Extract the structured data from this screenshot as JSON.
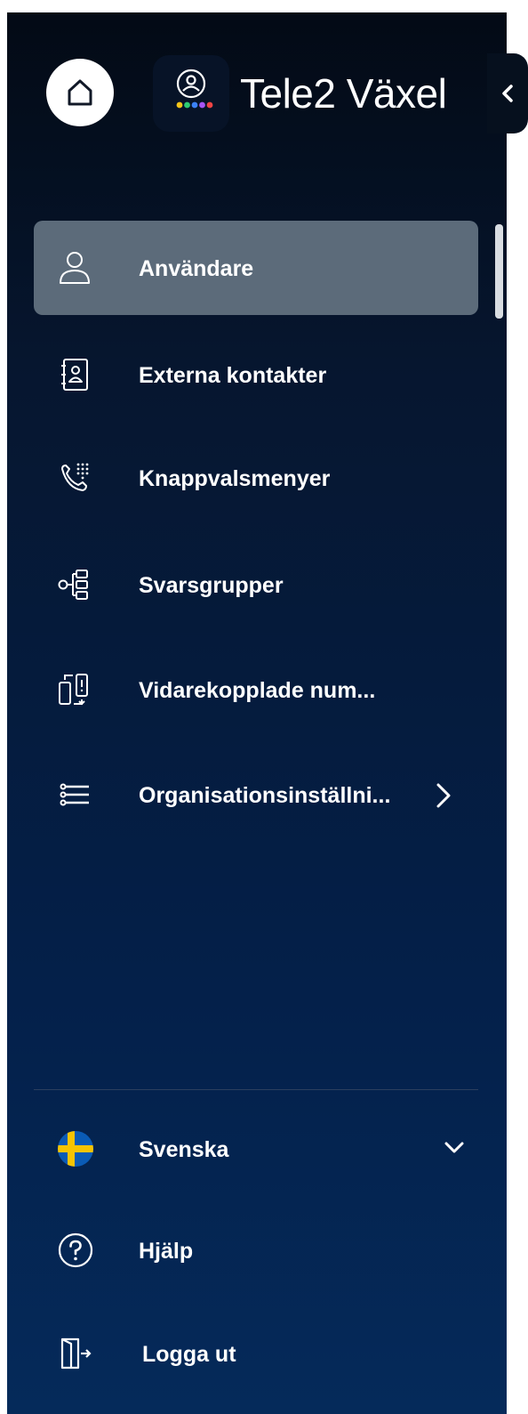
{
  "app": {
    "title": "Tele2 Växel"
  },
  "nav": {
    "items": [
      {
        "label": "Användare",
        "icon": "user-icon",
        "active": true
      },
      {
        "label": "Externa kontakter",
        "icon": "contact-book-icon",
        "active": false
      },
      {
        "label": "Knappvalsmenyer",
        "icon": "phone-keypad-icon",
        "active": false
      },
      {
        "label": "Svarsgrupper",
        "icon": "hierarchy-icon",
        "active": false
      },
      {
        "label": "Vidarekopplade num...",
        "icon": "phone-forward-icon",
        "active": false
      },
      {
        "label": "Organisationsinställni...",
        "icon": "sliders-icon",
        "active": false,
        "has_submenu": true
      }
    ]
  },
  "footer": {
    "language": "Svenska",
    "language_icon": "swedish-flag-icon",
    "help": "Hjälp",
    "help_icon": "help-circle-icon",
    "logout": "Logga ut",
    "logout_icon": "logout-door-icon"
  },
  "colors": {
    "sidebar_top": "#030a15",
    "sidebar_bottom": "#052a5a",
    "active_item": "#5c6b7a",
    "text": "#ffffff",
    "logo_dots": [
      "#f5c518",
      "#2ecc71",
      "#3b82f6",
      "#a855f7",
      "#ef4444"
    ]
  }
}
